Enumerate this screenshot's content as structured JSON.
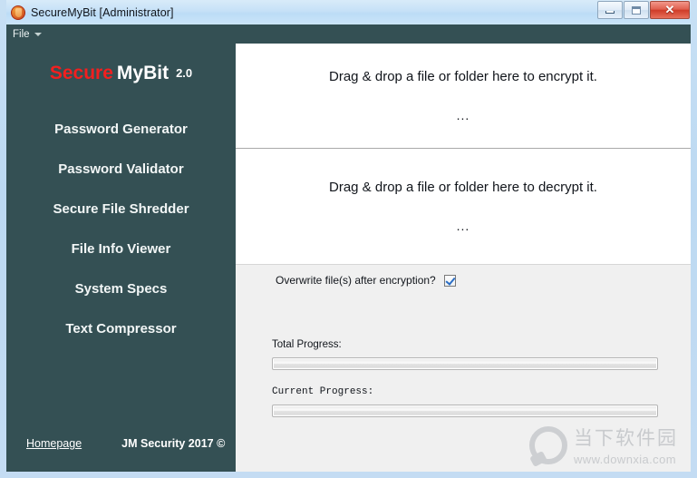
{
  "window": {
    "title": "SecureMyBit [Administrator]",
    "icon": "shield-badge-icon",
    "controls": {
      "minimize_label": "",
      "maximize_label": "",
      "close_label": "✕"
    }
  },
  "menubar": {
    "items": [
      {
        "label": "File",
        "has_dropdown": true
      }
    ]
  },
  "sidebar": {
    "logo": {
      "part1": "Secure",
      "part2": "MyBit",
      "version": "2.0",
      "part1_color": "#f21f1f",
      "part2_color": "#ffffff"
    },
    "background_color": "#345054",
    "items": [
      {
        "label": "Password Generator"
      },
      {
        "label": "Password Validator"
      },
      {
        "label": "Secure File Shredder"
      },
      {
        "label": "File Info Viewer"
      },
      {
        "label": "System Specs"
      },
      {
        "label": "Text Compressor"
      }
    ],
    "footer": {
      "link_label": "Homepage",
      "copyright": "JM Security 2017 ©"
    }
  },
  "main": {
    "encrypt_zone": {
      "title": "Drag & drop a file or folder here to encrypt it.",
      "status": "..."
    },
    "decrypt_zone": {
      "title": "Drag & drop a file or folder here to decrypt it.",
      "status": "..."
    },
    "options": {
      "overwrite_label": "Overwrite file(s) after encryption?",
      "overwrite_checked": true
    },
    "progress": {
      "total_label": "Total Progress:",
      "total_value": 0,
      "current_label": "Current Progress:",
      "current_value": 0
    }
  },
  "watermark": {
    "cn_text": "当下软件园",
    "url": "www.downxia.com"
  }
}
